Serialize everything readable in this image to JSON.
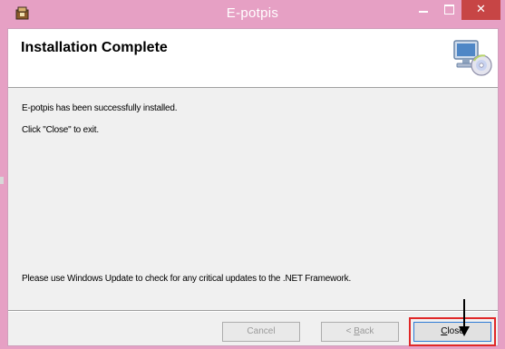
{
  "window": {
    "title": "E-potpis",
    "controls": {
      "minimize": "minimize",
      "maximize": "maximize",
      "close": "✕"
    }
  },
  "banner": {
    "title": "Installation Complete",
    "icon": "computer-cd-icon"
  },
  "body": {
    "line1": "E-potpis has been successfully installed.",
    "line2": "Click \"Close\" to exit.",
    "line3": "Please use Windows Update to check for any critical updates to the .NET Framework."
  },
  "buttons": {
    "cancel": {
      "label": "Cancel",
      "enabled": false
    },
    "back": {
      "prefix": "< ",
      "accel": "B",
      "rest": "ack",
      "enabled": false
    },
    "close": {
      "accel": "C",
      "rest": "lose",
      "enabled": true
    }
  },
  "annotation": {
    "highlight_color": "#e02828",
    "arrow": "down-arrow"
  },
  "colors": {
    "titlebar": "#e6a0c4",
    "close_button": "#c74545",
    "focus_border": "#2d7bd5"
  }
}
